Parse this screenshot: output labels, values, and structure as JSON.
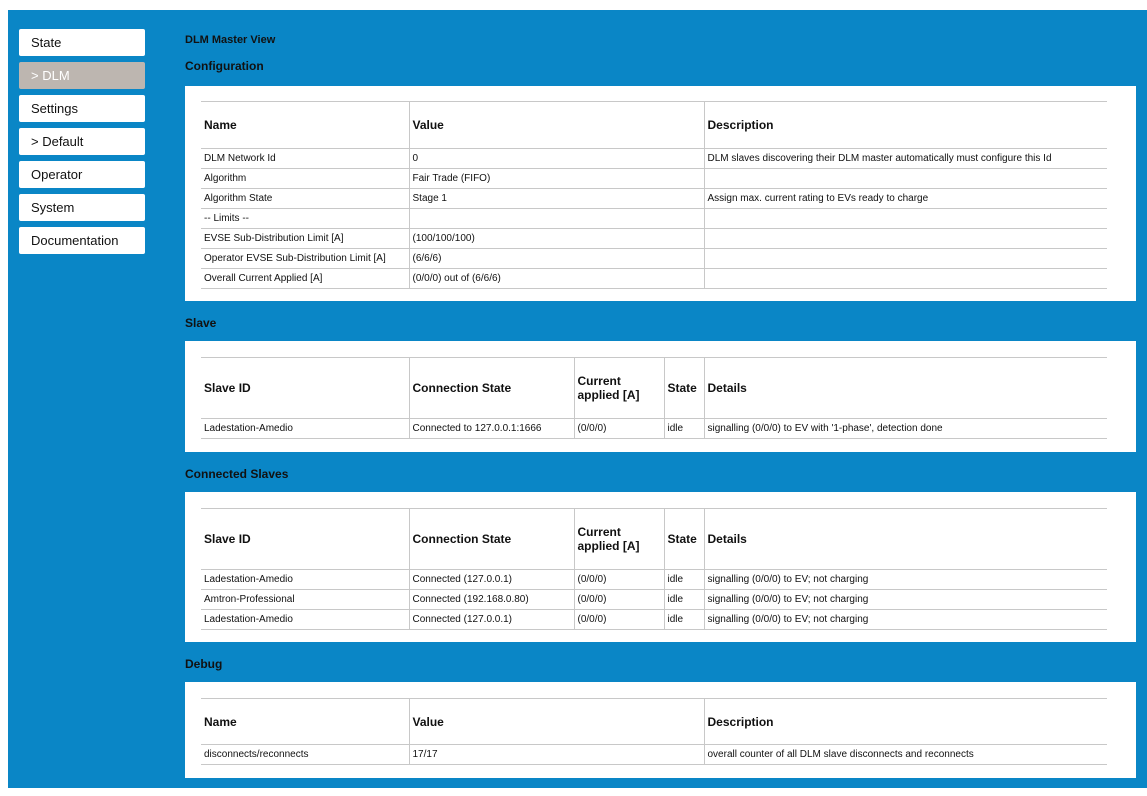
{
  "nav": {
    "items": [
      {
        "label": "State"
      },
      {
        "label": "> DLM"
      },
      {
        "label": "Settings"
      },
      {
        "label": "> Default"
      },
      {
        "label": "Operator"
      },
      {
        "label": "System"
      },
      {
        "label": "Documentation"
      }
    ],
    "active_index": 1
  },
  "page_title": "DLM Master View",
  "configuration": {
    "title": "Configuration",
    "headers": [
      "Name",
      "Value",
      "Description"
    ],
    "rows": [
      [
        "DLM Network Id",
        "0",
        "DLM slaves discovering their DLM master automatically must configure this Id"
      ],
      [
        "Algorithm",
        "Fair Trade (FIFO)",
        ""
      ],
      [
        "Algorithm State",
        "Stage 1",
        "Assign max. current rating to EVs ready to charge"
      ],
      [
        "-- Limits --",
        "",
        ""
      ],
      [
        "EVSE Sub-Distribution Limit [A]",
        "(100/100/100)",
        ""
      ],
      [
        "Operator EVSE Sub-Distribution Limit [A]",
        "(6/6/6)",
        ""
      ],
      [
        "Overall Current Applied [A]",
        "(0/0/0) out of (6/6/6)",
        ""
      ]
    ]
  },
  "slave": {
    "title": "Slave",
    "headers": [
      "Slave ID",
      "Connection State",
      "Current applied [A]",
      "State",
      "Details"
    ],
    "rows": [
      [
        "Ladestation-Amedio",
        "Connected to 127.0.0.1:1666",
        "(0/0/0)",
        "idle",
        "signalling (0/0/0) to EV with '1-phase', detection done"
      ]
    ]
  },
  "connected_slaves": {
    "title": "Connected Slaves",
    "headers": [
      "Slave ID",
      "Connection State",
      "Current applied [A]",
      "State",
      "Details"
    ],
    "rows": [
      [
        "Ladestation-Amedio",
        "Connected (127.0.0.1)",
        "(0/0/0)",
        "idle",
        "signalling (0/0/0) to EV; not charging"
      ],
      [
        "Amtron-Professional",
        "Connected (192.168.0.80)",
        "(0/0/0)",
        "idle",
        "signalling (0/0/0) to EV; not charging"
      ],
      [
        "Ladestation-Amedio",
        "Connected (127.0.0.1)",
        "(0/0/0)",
        "idle",
        "signalling (0/0/0) to EV; not charging"
      ]
    ]
  },
  "debug": {
    "title": "Debug",
    "headers": [
      "Name",
      "Value",
      "Description"
    ],
    "rows": [
      [
        "disconnects/reconnects",
        "17/17",
        "overall counter of all DLM slave disconnects and reconnects"
      ]
    ]
  }
}
